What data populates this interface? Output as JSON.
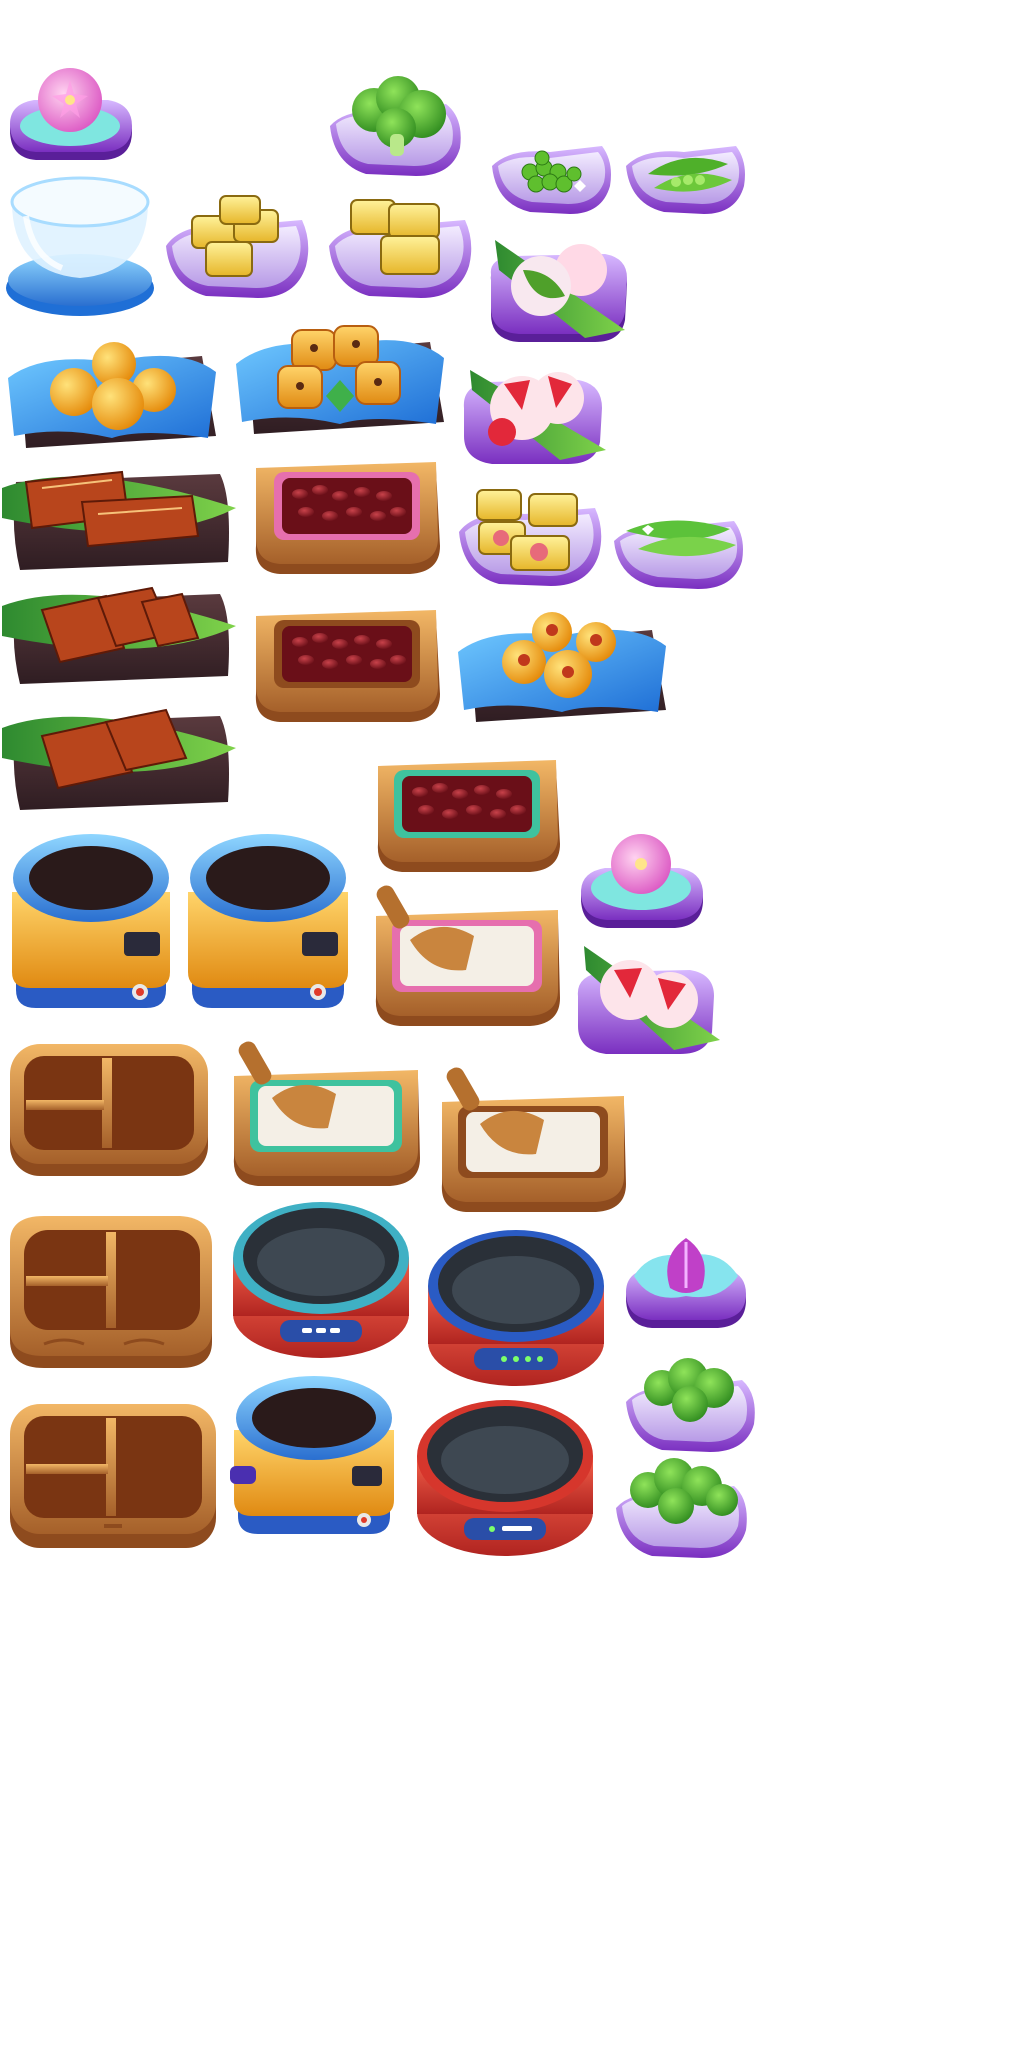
{
  "sheet": {
    "background": "#ffffff",
    "colors": {
      "plate_purple": "#8b3fc9",
      "plate_lilac": "#c9a8f0",
      "wood": "#c9853e",
      "blue_cloth": "#2f8fe8",
      "cooker_red": "#d6362c",
      "cooker_blue": "#3a78d8",
      "leaf_green": "#3fa83a"
    }
  },
  "sprites": [
    {
      "name": "flower-wagashi-pink-icon"
    },
    {
      "name": "broccoli-plate-icon"
    },
    {
      "name": "green-peas-plate-icon"
    },
    {
      "name": "pea-pods-plate-icon"
    },
    {
      "name": "glass-bowl-icon"
    },
    {
      "name": "tamagoyaki-plate-icon"
    },
    {
      "name": "tamagoyaki-plate-2-icon"
    },
    {
      "name": "matcha-mochi-plate-icon"
    },
    {
      "name": "golden-balls-tray-icon"
    },
    {
      "name": "glazed-pastries-tray-icon"
    },
    {
      "name": "strawberry-daifuku-plate-icon"
    },
    {
      "name": "grilled-eel-tray-icon"
    },
    {
      "name": "red-beans-box-icon"
    },
    {
      "name": "tamagoyaki-ham-plate-icon"
    },
    {
      "name": "snow-peas-plate-icon"
    },
    {
      "name": "grilled-eel-tray-2-icon"
    },
    {
      "name": "red-beans-box-2-icon"
    },
    {
      "name": "red-bean-buns-tray-icon"
    },
    {
      "name": "grilled-eel-tray-3-icon"
    },
    {
      "name": "red-beans-box-3-icon"
    },
    {
      "name": "rice-cooker-icon"
    },
    {
      "name": "rice-cooker-2-icon"
    },
    {
      "name": "rice-box-scoop-icon"
    },
    {
      "name": "flower-wagashi-lilac-icon"
    },
    {
      "name": "strawberry-daifuku-plate-2-icon"
    },
    {
      "name": "bento-box-icon"
    },
    {
      "name": "rice-box-scoop-2-icon"
    },
    {
      "name": "rice-box-scoop-3-icon"
    },
    {
      "name": "bento-box-2-icon"
    },
    {
      "name": "hot-pot-icon"
    },
    {
      "name": "hot-pot-2-icon"
    },
    {
      "name": "flower-wagashi-purple-icon"
    },
    {
      "name": "broccoli-plate-2-icon"
    },
    {
      "name": "bento-box-3-icon"
    },
    {
      "name": "rice-cooker-3-icon"
    },
    {
      "name": "hot-pot-3-icon"
    },
    {
      "name": "broccoli-plate-3-icon"
    }
  ]
}
